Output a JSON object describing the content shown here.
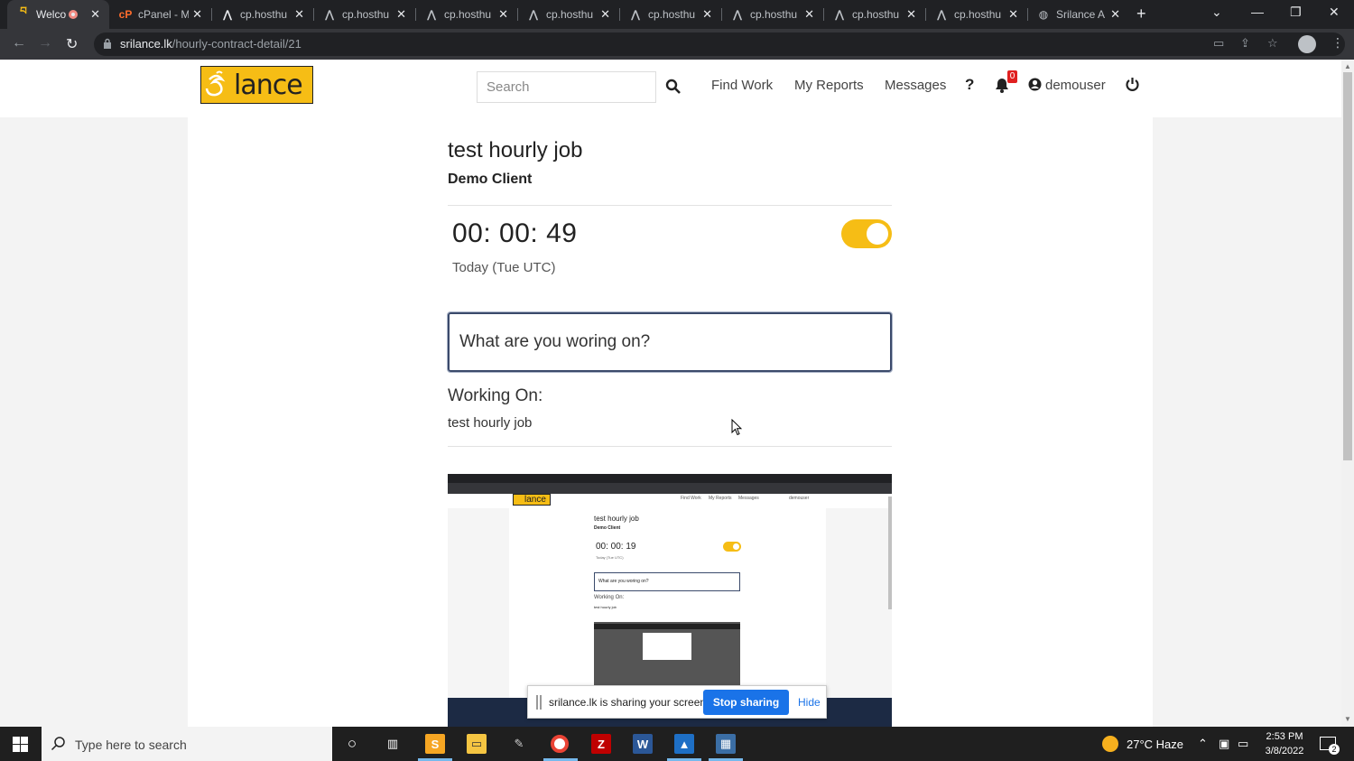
{
  "browser": {
    "tabs": [
      {
        "title": "Welco",
        "icon": "srilance-icon",
        "active": true,
        "recording": true
      },
      {
        "title": "cPanel - M",
        "icon": "cpanel-icon"
      },
      {
        "title": "cp.hosthu",
        "icon": "hosting-icon"
      },
      {
        "title": "cp.hosthu",
        "icon": "hosting-icon"
      },
      {
        "title": "cp.hosthu",
        "icon": "hosting-icon"
      },
      {
        "title": "cp.hosthu",
        "icon": "hosting-icon"
      },
      {
        "title": "cp.hosthu",
        "icon": "hosting-icon"
      },
      {
        "title": "cp.hosthu",
        "icon": "hosting-icon"
      },
      {
        "title": "cp.hosthu",
        "icon": "hosting-icon"
      },
      {
        "title": "cp.hosthu",
        "icon": "hosting-icon"
      },
      {
        "title": "Srilance A",
        "icon": "globe-icon"
      }
    ],
    "url_domain": "srilance.lk",
    "url_path": "/hourly-contract-detail/21"
  },
  "site": {
    "logo_text": "lance",
    "search_placeholder": "Search",
    "nav": {
      "find_work": "Find Work",
      "my_reports": "My Reports",
      "messages": "Messages",
      "help": "?",
      "notification_count": "0",
      "username": "demouser"
    }
  },
  "contract": {
    "job_title": "test hourly job",
    "client_name": "Demo Client",
    "timer": "00: 00: 49",
    "timer_running": true,
    "timer_period": "Today (Tue UTC)",
    "work_input_placeholder": "What are you woring on?",
    "working_on_label": "Working On:",
    "working_on_value": "test hourly job"
  },
  "captured_screenshot": {
    "job_title": "test hourly job",
    "client_name": "Demo Client",
    "timer": "00: 00: 19",
    "timer_period": "Today (Tue UTC)",
    "work_input_placeholder": "What are you woring on?",
    "working_on_label": "Working On:",
    "working_on_value": "test hourly job",
    "logo_text": "lance",
    "nav_find_work": "Find Work",
    "nav_my_reports": "My Reports",
    "nav_messages": "Messages",
    "nav_username": "demouser"
  },
  "share_bar": {
    "message": "srilance.lk is sharing your screen.",
    "stop_label": "Stop sharing",
    "hide_label": "Hide"
  },
  "taskbar": {
    "search_placeholder": "Type here to search",
    "weather": "27°C  Haze",
    "time": "2:53 PM",
    "date": "3/8/2022",
    "notification_count": "2"
  },
  "colors": {
    "brand_yellow": "#f6bd15",
    "chrome_dark": "#202124",
    "link_blue": "#1a73e8"
  }
}
